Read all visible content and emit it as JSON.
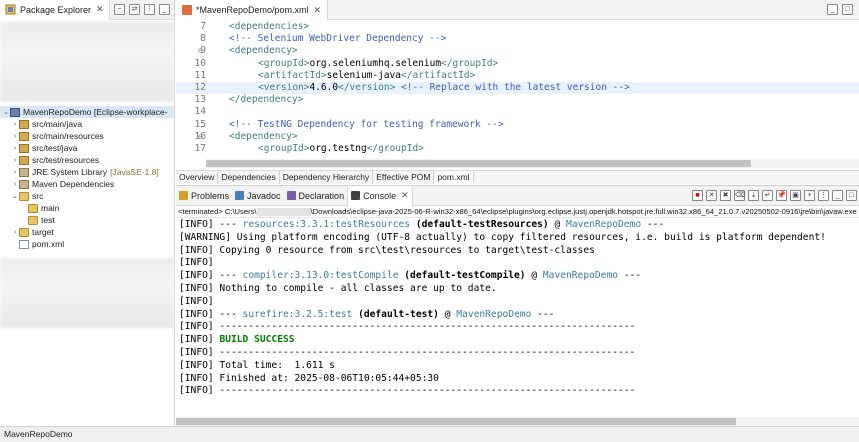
{
  "package_explorer": {
    "tab_title": "Package Explorer",
    "tree": [
      {
        "label": "MavenRepoDemo [Eclipse-workplace-",
        "icon": "project-icon",
        "expanded": true,
        "indent": 0
      },
      {
        "label": "src/main/java",
        "icon": "package-folder-icon",
        "indent": 1
      },
      {
        "label": "src/main/resources",
        "icon": "package-folder-icon",
        "indent": 1
      },
      {
        "label": "src/test/java",
        "icon": "package-folder-icon",
        "indent": 1
      },
      {
        "label": "src/test/resources",
        "icon": "package-folder-icon",
        "indent": 1
      },
      {
        "label": "JRE System Library",
        "suffix": "[JavaSE-1.8]",
        "icon": "library-icon",
        "indent": 1
      },
      {
        "label": "Maven Dependencies",
        "icon": "library-icon",
        "indent": 1
      },
      {
        "label": "src",
        "icon": "folder-icon",
        "expanded": true,
        "indent": 1
      },
      {
        "label": "main",
        "icon": "folder-icon",
        "indent": 2
      },
      {
        "label": "test",
        "icon": "folder-icon",
        "indent": 2
      },
      {
        "label": "target",
        "icon": "folder-icon",
        "indent": 1
      },
      {
        "label": "pom.xml",
        "icon": "xml-file-icon",
        "indent": 1
      }
    ]
  },
  "editor": {
    "tab_title": "*MavenRepoDemo/pom.xml",
    "lines": [
      {
        "num": "7",
        "fold": "",
        "parts": [
          [
            "tag",
            "<dependencies>"
          ]
        ],
        "indent": 0
      },
      {
        "num": "8",
        "fold": "",
        "parts": [
          [
            "cmt",
            "<!-- Selenium WebDriver Dependency -->"
          ]
        ],
        "indent": 0
      },
      {
        "num": "9",
        "fold": "⊖",
        "parts": [
          [
            "tag",
            "<dependency>"
          ]
        ],
        "indent": 0
      },
      {
        "num": "10",
        "fold": "",
        "parts": [
          [
            "tag",
            "<groupId>"
          ],
          [
            "txt",
            "org.seleniumhq.selenium"
          ],
          [
            "tag",
            "</groupId>"
          ]
        ],
        "indent": 1
      },
      {
        "num": "11",
        "fold": "",
        "parts": [
          [
            "tag",
            "<artifactId>"
          ],
          [
            "txt",
            "selenium-java"
          ],
          [
            "tag",
            "</artifactId>"
          ]
        ],
        "indent": 1
      },
      {
        "num": "12",
        "fold": "",
        "parts": [
          [
            "tag",
            "<version>"
          ],
          [
            "txt",
            "4.6.0"
          ],
          [
            "tag",
            "</version>"
          ],
          [
            "txt",
            " "
          ],
          [
            "cmt",
            "<!-- Replace with the latest version -->"
          ]
        ],
        "indent": 1,
        "current": true
      },
      {
        "num": "13",
        "fold": "",
        "parts": [
          [
            "tag",
            "</dependency>"
          ]
        ],
        "indent": 0
      },
      {
        "num": "14",
        "fold": "",
        "parts": [],
        "indent": 0
      },
      {
        "num": "15",
        "fold": "",
        "parts": [
          [
            "cmt",
            "<!-- TestNG Dependency for testing framework -->"
          ]
        ],
        "indent": 0
      },
      {
        "num": "16",
        "fold": "⊖",
        "parts": [
          [
            "tag",
            "<dependency>"
          ]
        ],
        "indent": 0
      },
      {
        "num": "17",
        "fold": "",
        "parts": [
          [
            "tag",
            "<groupId>"
          ],
          [
            "txt",
            "org.testng"
          ],
          [
            "tag",
            "</groupId>"
          ]
        ],
        "indent": 1
      }
    ],
    "pom_tabs": [
      "Overview",
      "Dependencies",
      "Dependency Hierarchy",
      "Effective POM",
      "pom.xml"
    ],
    "active_pom_tab": "pom.xml"
  },
  "console_view": {
    "tabs": [
      {
        "label": "Problems",
        "icon": "problems-icon"
      },
      {
        "label": "Javadoc",
        "icon": "javadoc-icon"
      },
      {
        "label": "Declaration",
        "icon": "declaration-icon"
      },
      {
        "label": "Console",
        "icon": "console-icon",
        "active": true
      }
    ],
    "terminated_prefix": "<terminated> C:\\Users\\",
    "terminated_suffix": "\\Downloads\\eclipse-java-2025-06-R-win32-x86_64\\eclipse\\plugins\\org.eclipse.justj.openjdk.hotspot.jre.full.win32.x86_64_21.0.7.v20250502-0916\\jre\\bin\\javaw.exe",
    "lines": [
      [
        [
          "n",
          "[INFO] --- "
        ],
        [
          "plug",
          "resources:3.3.1:testResources"
        ],
        [
          "b",
          " (default-testResources)"
        ],
        [
          "n",
          " @ "
        ],
        [
          "proj",
          "MavenRepoDemo"
        ],
        [
          "n",
          " ---"
        ]
      ],
      [
        [
          "n",
          "[WARNING] Using platform encoding (UTF-8 actually) to copy filtered resources, i.e. build is platform dependent!"
        ]
      ],
      [
        [
          "n",
          "[INFO] Copying 0 resource from src\\test\\resources to target\\test-classes"
        ]
      ],
      [
        [
          "n",
          "[INFO]"
        ]
      ],
      [
        [
          "n",
          "[INFO] --- "
        ],
        [
          "plug",
          "compiler:3.13.0:testCompile"
        ],
        [
          "b",
          " (default-testCompile)"
        ],
        [
          "n",
          " @ "
        ],
        [
          "proj",
          "MavenRepoDemo"
        ],
        [
          "n",
          " ---"
        ]
      ],
      [
        [
          "n",
          "[INFO] Nothing to compile - all classes are up to date."
        ]
      ],
      [
        [
          "n",
          "[INFO]"
        ]
      ],
      [
        [
          "n",
          "[INFO] --- "
        ],
        [
          "plug",
          "surefire:3.2.5:test"
        ],
        [
          "b",
          " (default-test)"
        ],
        [
          "n",
          " @ "
        ],
        [
          "proj",
          "MavenRepoDemo"
        ],
        [
          "n",
          " ---"
        ]
      ],
      [
        [
          "n",
          "[INFO] ------------------------------------------------------------------------"
        ]
      ],
      [
        [
          "n",
          "[INFO] "
        ],
        [
          "ok",
          "BUILD SUCCESS"
        ]
      ],
      [
        [
          "n",
          "[INFO] ------------------------------------------------------------------------"
        ]
      ],
      [
        [
          "n",
          "[INFO] Total time:  1.611 s"
        ]
      ],
      [
        [
          "n",
          "[INFO] Finished at: 2025-08-06T10:05:44+05:30"
        ]
      ],
      [
        [
          "n",
          "[INFO] ------------------------------------------------------------------------"
        ]
      ]
    ]
  },
  "status_bar": {
    "text": "MavenRepoDemo"
  }
}
